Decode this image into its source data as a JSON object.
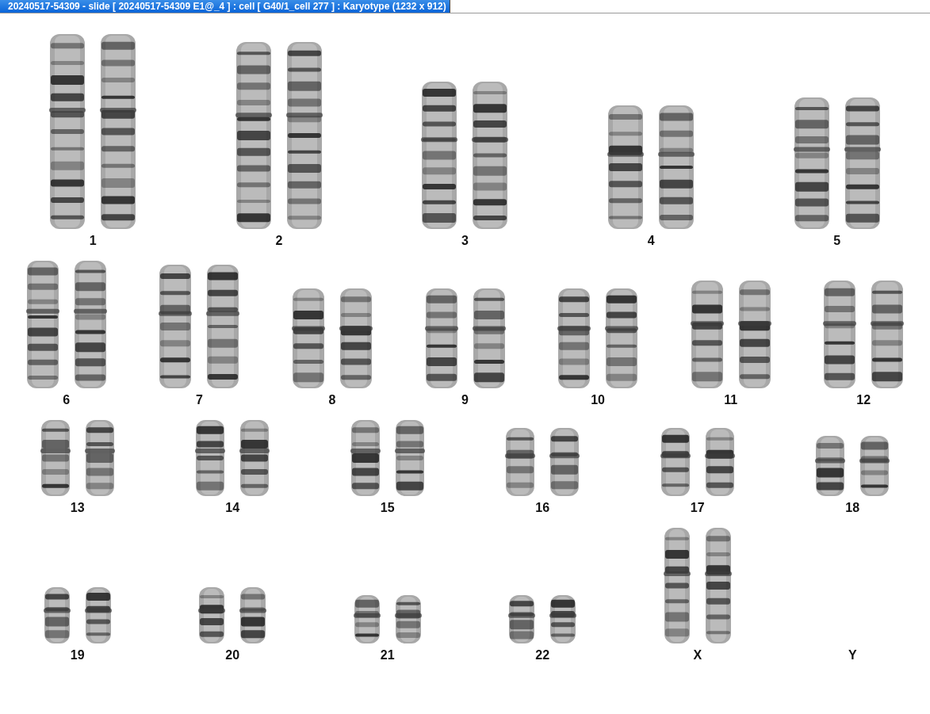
{
  "window": {
    "title": "20240517-54309 - slide [ 20240517-54309 E1@_4 ] : cell [ G40/1_cell 277 ] : Karyotype  (1232 x 912)"
  },
  "karyotype": {
    "rows": [
      {
        "pairs": [
          {
            "label": "1",
            "present": true
          },
          {
            "label": "2",
            "present": true
          },
          {
            "label": "3",
            "present": true
          },
          {
            "label": "4",
            "present": true
          },
          {
            "label": "5",
            "present": true
          }
        ]
      },
      {
        "pairs": [
          {
            "label": "6",
            "present": true
          },
          {
            "label": "7",
            "present": true
          },
          {
            "label": "8",
            "present": true
          },
          {
            "label": "9",
            "present": true
          },
          {
            "label": "10",
            "present": true
          },
          {
            "label": "11",
            "present": true
          },
          {
            "label": "12",
            "present": true
          }
        ]
      },
      {
        "pairs": [
          {
            "label": "13",
            "present": true
          },
          {
            "label": "14",
            "present": true
          },
          {
            "label": "15",
            "present": true
          },
          {
            "label": "16",
            "present": true
          },
          {
            "label": "17",
            "present": true
          },
          {
            "label": "18",
            "present": true
          }
        ]
      },
      {
        "pairs": [
          {
            "label": "19",
            "present": true
          },
          {
            "label": "20",
            "present": true
          },
          {
            "label": "21",
            "present": true
          },
          {
            "label": "22",
            "present": true
          },
          {
            "label": "X",
            "present": true
          },
          {
            "label": "Y",
            "present": false
          }
        ]
      }
    ]
  }
}
